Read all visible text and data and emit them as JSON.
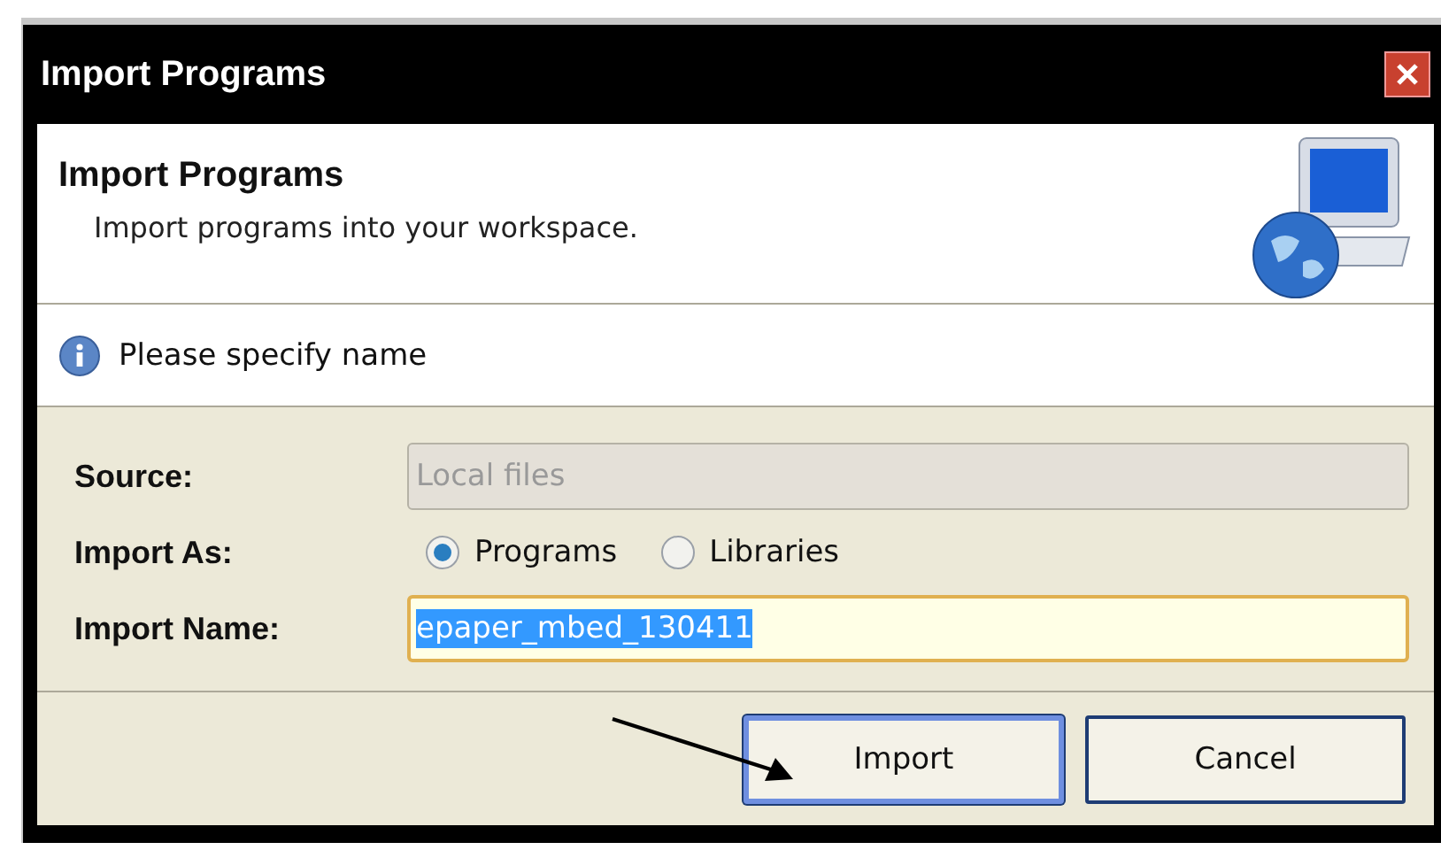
{
  "window": {
    "title": "Import Programs"
  },
  "header": {
    "title": "Import Programs",
    "subtitle": "Import programs into your workspace."
  },
  "message": {
    "kind": "info",
    "text": "Please specify name"
  },
  "form": {
    "source": {
      "label": "Source:",
      "value": "Local files",
      "disabled": true
    },
    "import_as": {
      "label": "Import As:",
      "options": [
        {
          "label": "Programs",
          "selected": true
        },
        {
          "label": "Libraries",
          "selected": false
        }
      ]
    },
    "import_name": {
      "label": "Import Name:",
      "value": "epaper_mbed_130411",
      "highlighted": true
    }
  },
  "buttons": [
    {
      "label": "Import",
      "default": true
    },
    {
      "label": "Cancel",
      "default": false
    }
  ]
}
